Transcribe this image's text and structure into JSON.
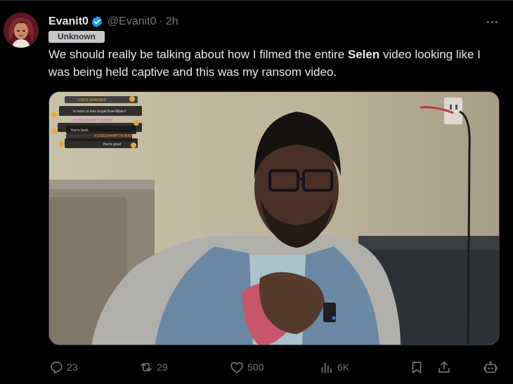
{
  "tweet": {
    "display_name": "Evanit0",
    "handle": "@Evanit0",
    "separator": "·",
    "time": "2h",
    "badge": "Unknown",
    "text_part1": "We should really be talking about how I filmed the entire ",
    "text_bold": "Selen",
    "text_part2": " video looking like I was being held captive and this was my ransom video."
  },
  "media": {
    "chat_overlay": [
      {
        "user": "LORDLUNARSEN",
        "message": "Is more or less stupid than Mjlaird",
        "user_color": "#e8a33c"
      },
      {
        "user": "ROSIESHAMPTHONINY",
        "message": "You're back",
        "user_color": "#d94ad9"
      },
      {
        "user": "ROSIESHAMPTHONINY",
        "message": "You're good",
        "user_color": "#e8a33c"
      }
    ]
  },
  "actions": {
    "replies": "23",
    "reposts": "29",
    "likes": "500",
    "views": "6K"
  },
  "colors": {
    "background": "#000000",
    "text": "#e7e9ea",
    "muted": "#71767b",
    "verified_blue": "#1d9bf0",
    "badge_bg": "#c5c7c9"
  },
  "icons": {
    "verified": "verified-badge-icon",
    "more": "more-icon",
    "reply": "reply-icon",
    "repost": "repost-icon",
    "like": "heart-icon",
    "views": "analytics-icon",
    "bookmark": "bookmark-icon",
    "share": "share-icon",
    "grok": "grok-icon"
  }
}
